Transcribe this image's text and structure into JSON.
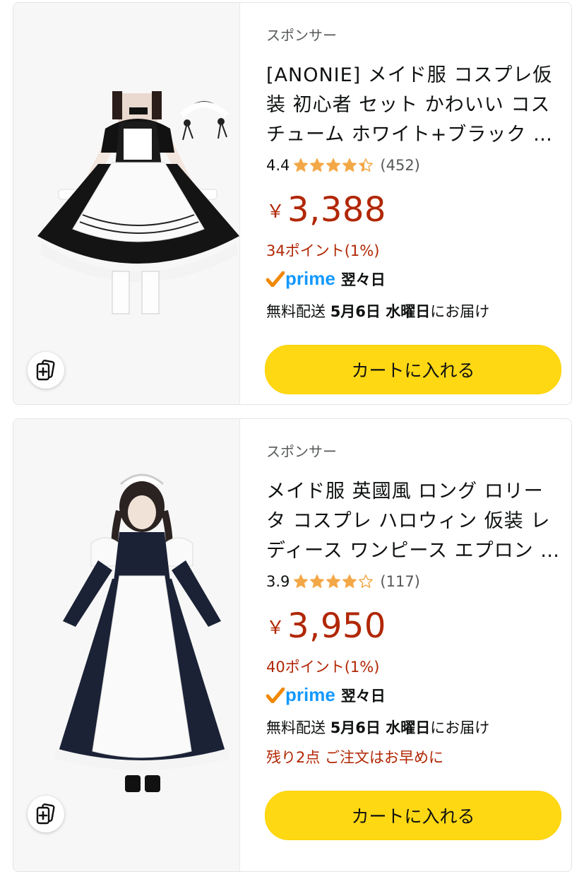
{
  "products": [
    {
      "sponsored": "スポンサー",
      "title": "[ANONIE] メイド服 コスプレ仮装 初心者 セット かわいい コスチューム ホワイト+ブラック …",
      "rating": "4.4",
      "stars": 4.4,
      "review_count": "(452)",
      "currency": "￥",
      "price": "3,388",
      "points": "34ポイント(1%)",
      "prime_word": "prime",
      "prime_day": "翌々日",
      "delivery_prefix": "無料配送 ",
      "delivery_date": "5月6日 水曜日",
      "delivery_suffix": "にお届け",
      "cart_label": "カートに入れる",
      "image_icon": "maid-outfit-short-image",
      "compare_icon": "add-to-compare-icon"
    },
    {
      "sponsored": "スポンサー",
      "title": "メイド服 英國風 ロング ロリータ コスプレ ハロウィン 仮装 レディース ワンピース エプロン …",
      "rating": "3.9",
      "stars": 3.9,
      "review_count": "(117)",
      "currency": "￥",
      "price": "3,950",
      "points": "40ポイント(1%)",
      "prime_word": "prime",
      "prime_day": "翌々日",
      "delivery_prefix": "無料配送 ",
      "delivery_date": "5月6日 水曜日",
      "delivery_suffix": "にお届け",
      "stock_notice": "残り2点 ご注文はお早めに",
      "cart_label": "カートに入れる",
      "image_icon": "maid-outfit-long-image",
      "compare_icon": "add-to-compare-icon"
    }
  ],
  "colors": {
    "price": "#b12704",
    "star": "#f3a847",
    "prime": "#1399ff",
    "prime_check": "#f08804",
    "cart_button": "#ffd814"
  }
}
